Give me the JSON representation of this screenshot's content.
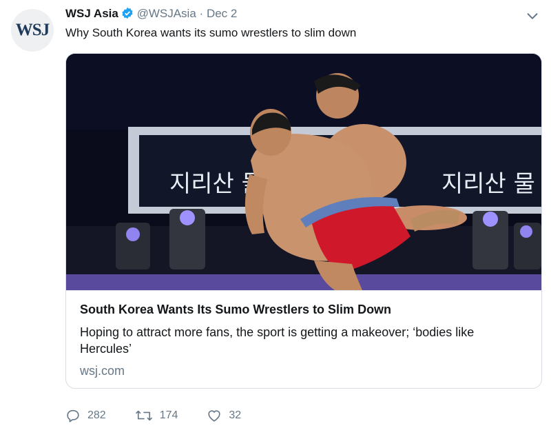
{
  "tweet": {
    "avatar_text": "WSJ",
    "author_name": "WSJ Asia",
    "handle": "@WSJAsia",
    "separator": "·",
    "date": "Dec 2",
    "text": "Why South Korea wants its sumo wrestlers to slim down"
  },
  "card": {
    "title": "South Korea Wants Its Sumo Wrestlers to Slim Down",
    "description": "Hoping to attract more fans, the sport is getting a makeover; ‘bodies like Hercules’",
    "domain": "wsj.com",
    "banner_text": "지리산 물",
    "banner_text_right": "지리산 물"
  },
  "actions": {
    "replies": "282",
    "retweets": "174",
    "likes": "32"
  },
  "colors": {
    "verified": "#1da1f2",
    "icon_gray": "#657786",
    "accent_red": "#d0182b"
  },
  "icons": {
    "reply": "reply-icon",
    "retweet": "retweet-icon",
    "like": "heart-icon",
    "menu": "chevron-down-icon",
    "verified": "verified-badge-icon"
  }
}
